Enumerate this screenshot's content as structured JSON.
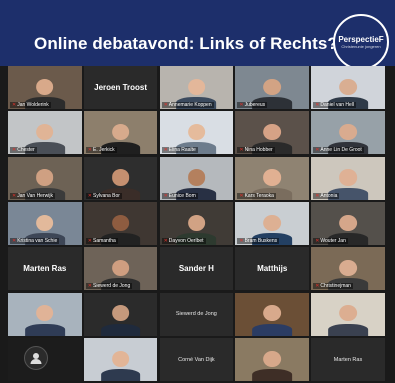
{
  "title": "Online debatavond: Links of Rechts?",
  "logo": {
    "line1": "PerspectieF",
    "line2": "Christenunie jongeren"
  },
  "tiles": [
    {
      "name": "Jan Wolderink",
      "bg": "#6b5a4b",
      "skin": "#d8a98a",
      "shirt": "#2c2c2c",
      "kind": "video"
    },
    {
      "name": "Jeroen Troost",
      "bg": "#2a2a2a",
      "kind": "label"
    },
    {
      "name": "Annemarie Koppen",
      "bg": "#b8b4ae",
      "skin": "#e3b79a",
      "shirt": "#3b4a5e",
      "kind": "video"
    },
    {
      "name": "Jubereus",
      "bg": "#7e8891",
      "skin": "#d2a384",
      "shirt": "#2d3137",
      "kind": "video"
    },
    {
      "name": "Daniel van Hell",
      "bg": "#d0d4da",
      "skin": "#d9ae92",
      "shirt": "#2f3a48",
      "kind": "video"
    },
    {
      "name": "Chester",
      "bg": "#c2c5c7",
      "skin": "#e0b496",
      "shirt": "#4a4f57",
      "kind": "video"
    },
    {
      "name": "E. Jerkick",
      "bg": "#8d7f6c",
      "skin": "#d7aa8c",
      "shirt": "#1f1f1f",
      "kind": "video"
    },
    {
      "name": "Elina Raalte",
      "bg": "#d9dee4",
      "skin": "#e5bb9c",
      "shirt": "#6d7c8c",
      "kind": "video"
    },
    {
      "name": "Nina Hobber",
      "bg": "#5b514a",
      "skin": "#d6a286",
      "shirt": "#2a2a2a",
      "kind": "video"
    },
    {
      "name": "Anne Lin De Groot",
      "bg": "#97a1a8",
      "skin": "#d9ab8f",
      "shirt": "#30333a",
      "kind": "video"
    },
    {
      "name": "Jan Van Herwijk",
      "bg": "#6d6255",
      "skin": "#cfa082",
      "shirt": "#3b3b3b",
      "kind": "video"
    },
    {
      "name": "Sylvana Bor",
      "bg": "#2e2e2e",
      "skin": "#c59070",
      "shirt": "#3a2d28",
      "kind": "video"
    },
    {
      "name": "Eunice Bom",
      "bg": "#b5b9bd",
      "skin": "#b4805e",
      "shirt": "#283044",
      "kind": "video"
    },
    {
      "name": "Kars Teraoka",
      "bg": "#8f8372",
      "skin": "#e1b092",
      "shirt": "#7a6d5e",
      "kind": "video"
    },
    {
      "name": "Antonia",
      "bg": "#cdc7bd",
      "skin": "#dfb195",
      "shirt": "#46546a",
      "kind": "video"
    },
    {
      "name": "Kristina van Schie",
      "bg": "#7a8796",
      "skin": "#e2b99b",
      "shirt": "#3d4656",
      "kind": "video"
    },
    {
      "name": "Samantha",
      "bg": "#3f3732",
      "skin": "#8e5c40",
      "shirt": "#222222",
      "kind": "video"
    },
    {
      "name": "Dayvon Oerlbet",
      "bg": "#403b36",
      "skin": "#d1a284",
      "shirt": "#2d3a2f",
      "kind": "video"
    },
    {
      "name": "Bram Buskens",
      "bg": "#c9ced2",
      "skin": "#ddb093",
      "shirt": "#234063",
      "kind": "video"
    },
    {
      "name": "Wouter Jan",
      "bg": "#54504b",
      "skin": "#d5a68a",
      "shirt": "#282828",
      "kind": "video"
    },
    {
      "name": "Marten Ras",
      "bg": "#2a2a2a",
      "kind": "label"
    },
    {
      "name": "Siewerd de Jong",
      "bg": "#6e6358",
      "skin": "#cf9e80",
      "shirt": "#2d2d2d",
      "kind": "video"
    },
    {
      "name": "Sander H",
      "bg": "#2a2a2a",
      "kind": "label"
    },
    {
      "name": "Matthijs",
      "bg": "#2a2a2a",
      "kind": "label"
    },
    {
      "name": "Christinejman",
      "bg": "#7b6a56",
      "skin": "#d9ac90",
      "shirt": "#3a3a3a",
      "kind": "video"
    },
    {
      "name": "",
      "bg": "#a8b3bd",
      "skin": "#e0b397",
      "shirt": "#2f3c56",
      "kind": "video"
    },
    {
      "name": "",
      "bg": "#2b2b2b",
      "skin": "#c5997c",
      "shirt": "#1f2a3c",
      "kind": "video"
    },
    {
      "name": "Siewerd de Jong",
      "bg": "#2a2a2a",
      "kind": "text"
    },
    {
      "name": "",
      "bg": "#6b4f36",
      "skin": "#d8a98c",
      "shirt": "#2b3c63",
      "kind": "video"
    },
    {
      "name": "",
      "bg": "#d8d2c6",
      "skin": "#dcae91",
      "shirt": "#3a4150",
      "kind": "video"
    },
    {
      "name": "",
      "bg": "#1c1c1c",
      "kind": "avatar"
    },
    {
      "name": "",
      "bg": "#c8cdd3",
      "skin": "#e2b597",
      "shirt": "#2e3a4f",
      "kind": "video"
    },
    {
      "name": "Corné Van Dijk",
      "bg": "#2a2a2a",
      "kind": "text"
    },
    {
      "name": "",
      "bg": "#8a7a62",
      "skin": "#d7a88a",
      "shirt": "#3e2e26",
      "kind": "video"
    },
    {
      "name": "Marten Ras",
      "bg": "#2a2a2a",
      "kind": "text"
    }
  ]
}
